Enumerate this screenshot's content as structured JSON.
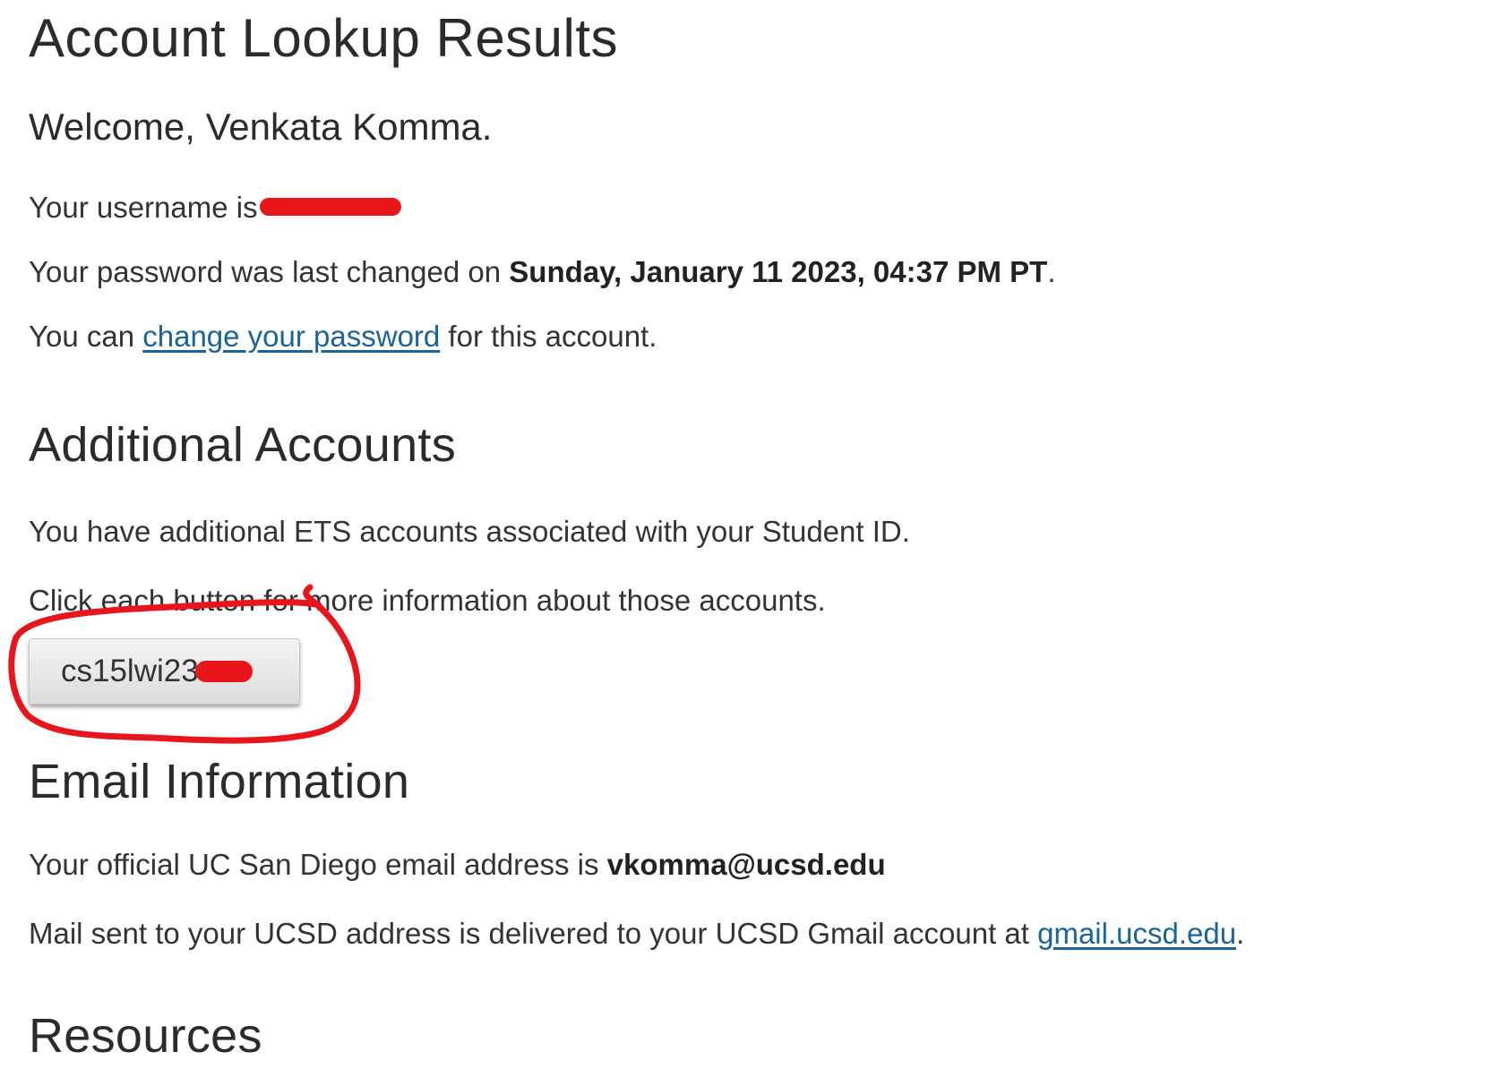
{
  "page": {
    "title": "Account Lookup Results",
    "welcome": "Welcome, Venkata Komma.",
    "username_prefix": "Your username is",
    "password_prefix": "Your password was last changed on ",
    "password_date": "Sunday, January 11 2023, 04:37 PM PT",
    "password_suffix": ".",
    "change_prefix": "You can ",
    "change_link": "change your password",
    "change_suffix": " for this account."
  },
  "additional": {
    "heading": "Additional Accounts",
    "line1": "You have additional ETS accounts associated with your Student ID.",
    "line2": "Click each button for more information about those accounts.",
    "account_button_label": "cs15lwi23"
  },
  "email": {
    "heading": "Email Information",
    "official_prefix": "Your official UC San Diego email address is ",
    "official_address": "vkomma@ucsd.edu",
    "mail_prefix": "Mail sent to your UCSD address is delivered to your UCSD Gmail account at ",
    "mail_link": "gmail.ucsd.edu",
    "mail_suffix": "."
  },
  "resources": {
    "heading": "Resources"
  },
  "annotation": {
    "color": "#e8161b"
  }
}
